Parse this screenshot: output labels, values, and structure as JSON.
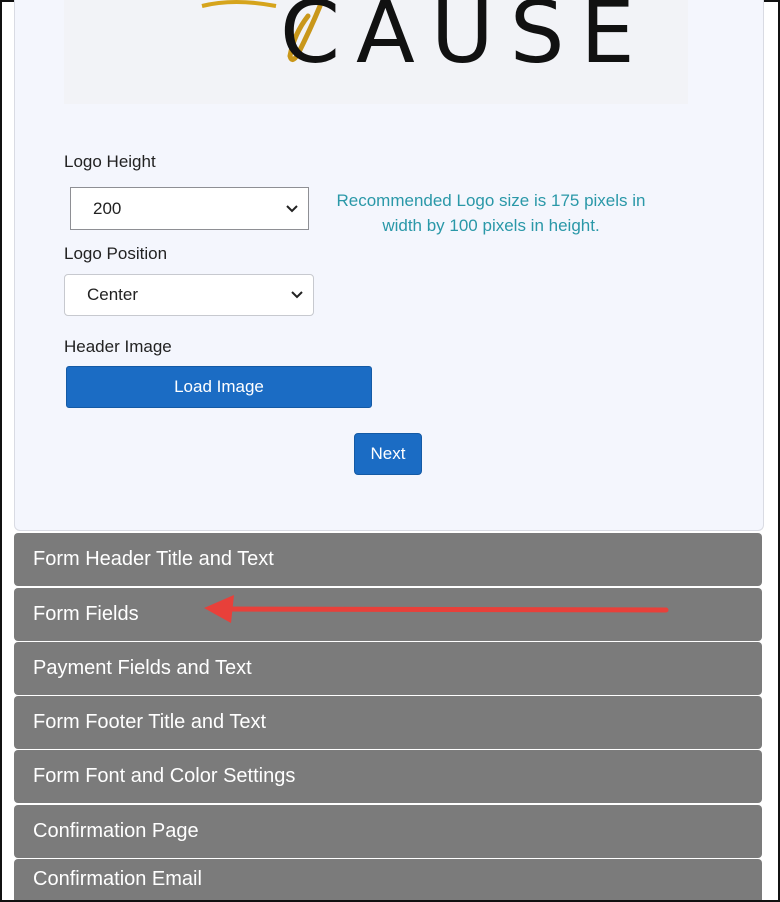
{
  "logo": {
    "text": "CAUSE"
  },
  "logo_height": {
    "label": "Logo Height",
    "value": "200"
  },
  "recommendation": "Recommended Logo size is 175 pixels in width by 100 pixels in height.",
  "logo_position": {
    "label": "Logo Position",
    "value": "Center"
  },
  "header_image": {
    "label": "Header Image",
    "button": "Load Image"
  },
  "next_button": "Next",
  "sections": [
    "Form Header Title and Text",
    "Form Fields",
    "Payment Fields and Text",
    "Form Footer Title and Text",
    "Form Font and Color Settings",
    "Confirmation Page",
    "Confirmation Email"
  ],
  "colors": {
    "accent": "#1b6cc4",
    "section_bg": "#7b7b7b",
    "recommendation_text": "#2a98a8",
    "annotation_arrow": "#e8403a"
  },
  "icons": [
    "chevron-down-icon",
    "annotation-arrow"
  ]
}
